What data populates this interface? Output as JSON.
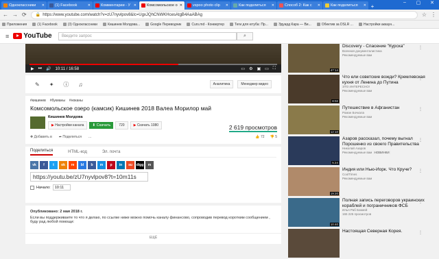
{
  "browser": {
    "tabs": [
      {
        "label": "Одноклассники",
        "color": "#ee8208"
      },
      {
        "label": "(1) Facebook",
        "color": "#3b5998"
      },
      {
        "label": "Комментарии - У",
        "color": "#e00"
      },
      {
        "label": "Комсомольское о",
        "color": "#e00"
      },
      {
        "label": "vspoo photo clip",
        "color": "#e00"
      },
      {
        "label": "Как поделиться",
        "color": "#6aa"
      },
      {
        "label": "Способ 2: Как с",
        "color": "#e55"
      },
      {
        "label": "Как поделиться",
        "color": "#ec3"
      }
    ],
    "url": "https://www.youtube.com/watch?v=zU7nyvlpov8&lc=UgxJQhCNWKHcesAtgB4AaABAg",
    "bookmarks": [
      "Приложения",
      "(1) Facebook",
      "(3) Одноклассники",
      "Кишинев Молдова...",
      "Google Переводчик",
      "Curs.md - Конвертер",
      "Теги для ютуба: Пр...",
      "Эдуард Кара — Ви...",
      "Обектив за DSLR ...",
      "Настройки аккаун..."
    ]
  },
  "youtube": {
    "search_placeholder": "Введите запрос"
  },
  "player": {
    "time": "10:11 / 16:58",
    "progress": 0.6
  },
  "actions": {
    "analytics": "Аналитика",
    "manager": "Менеджер видео"
  },
  "video": {
    "tags": [
      "#кишинев",
      "#букианы",
      "#ноканы"
    ],
    "title": "Комсомольское озеро (камсик) Кишинев 2018 Валеа Морилор май",
    "channel": "Кишинев Молдова",
    "settings": "Настройки канала",
    "subscribe": "Скачать",
    "sub_count": "720",
    "download": "Скачать 1080",
    "views": "2 619 просмотров",
    "add": "Добавить в",
    "share": "Поделиться",
    "more": "...",
    "likes": "72",
    "dislikes": "5"
  },
  "share": {
    "tabs": [
      "Поделиться",
      "HTML-код",
      "Эл. почта"
    ],
    "socials": [
      {
        "t": "vk",
        "c": "#4a76a8"
      },
      {
        "t": "f",
        "c": "#3b5998"
      },
      {
        "t": "t",
        "c": "#1da1f2"
      },
      {
        "t": "ok",
        "c": "#ee8208"
      },
      {
        "t": "re",
        "c": "#ff4500"
      },
      {
        "t": "bl",
        "c": "#2a7ae2"
      },
      {
        "t": "b",
        "c": "#3a5a9a"
      },
      {
        "t": "m",
        "c": "#168de2"
      },
      {
        "t": "p",
        "c": "#bd081c"
      },
      {
        "t": "in",
        "c": "#0077b5"
      },
      {
        "t": "su",
        "c": "#eb4924"
      },
      {
        "t": "digg",
        "c": "#000"
      },
      {
        "t": "m",
        "c": "#555"
      }
    ],
    "link": "https://youtu.be/zU7nyvlpov8?t=10m11s",
    "start_label": "Начало:",
    "start_value": "10:11"
  },
  "description": {
    "published": "Опубликовано: 2 мая 2018 г.",
    "text": "Если вы поддерживаете то что я делаю, по ссылке ниже можно помочь каналу финансово, сопроводив перевод коротким сообщением , буду рад любой помощи:",
    "more": "ЕЩЁ"
  },
  "recs": [
    {
      "title": "Discovery - Спасение \"Курска\"",
      "ch": "Военная документалистика",
      "meta": "Рекомендуемые вам",
      "dur": "47:14",
      "c": "#6a5a3a"
    },
    {
      "title": "Что ели советские вожди? Кремлевская кухня от Ленина до Путина",
      "ch": "ЭТО ИНТЕРЕСНО!",
      "meta": "Рекомендуемые вам",
      "dur": "8:02",
      "c": "#4a3a2a"
    },
    {
      "title": "Путешествие в Афганистан",
      "ch": "Роман Бочкала",
      "meta": "Рекомендуемые вам",
      "dur": "12:10",
      "c": "#8a7a4a"
    },
    {
      "title": "Азаров рассказал, почему выгнал Порошенко из своего Правительства",
      "ch": "Николай Азаров",
      "meta": "Рекомендуемые вам",
      "dur": "5:24",
      "c": "#2a3a5a",
      "badge": "НОВИНКИ"
    },
    {
      "title": "Индия или Нью-Йорк. Что Круче?",
      "ch": "CoolTimes",
      "meta": "Рекомендуемые вам",
      "dur": "19:20",
      "c": "#b08a6a"
    },
    {
      "title": "Полная запись переговоров украинских кораблей и пограничников ФСБ",
      "ch": "Илья Раб Бэкмей",
      "meta": "165 225 просмотров",
      "dur": "10:40",
      "c": "#3a6a8a"
    },
    {
      "title": "Настоящая Северная Корея.",
      "ch": "",
      "meta": "",
      "dur": "",
      "c": "#5a4a3a"
    }
  ]
}
